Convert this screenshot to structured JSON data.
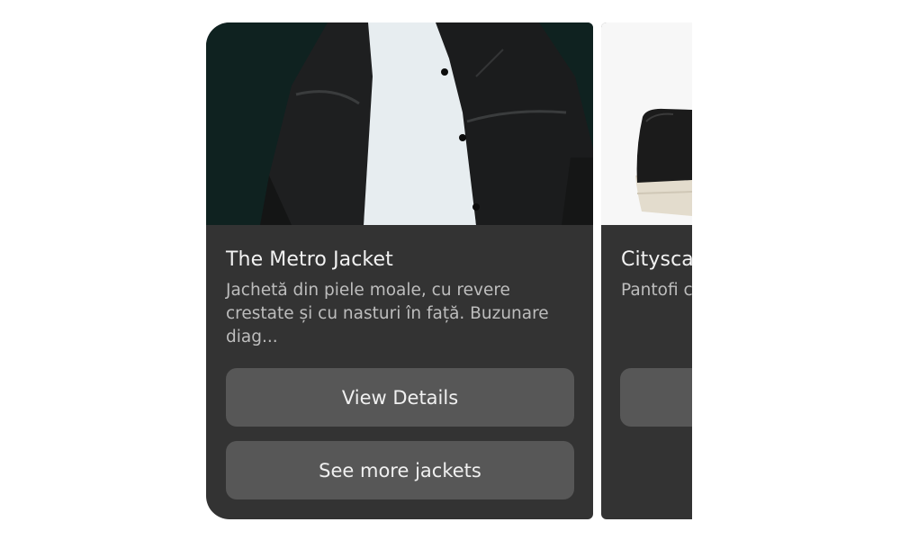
{
  "cards": [
    {
      "title": "The Metro Jacket",
      "description": "Jachetă din piele moale, cu revere crestate și cu nasturi în față. Buzunare diag...",
      "buttons": [
        "View Details",
        "See more jackets"
      ],
      "image": "leather-jacket-photo"
    },
    {
      "title": "Citysca",
      "description": "Pantofi c margine ș...",
      "buttons": [
        ""
      ],
      "image": "black-sneaker-photo"
    }
  ],
  "colors": {
    "card_bg": "#333333",
    "button_bg": "#575757",
    "title": "#f2f2f2",
    "description": "#bdbdbd"
  }
}
